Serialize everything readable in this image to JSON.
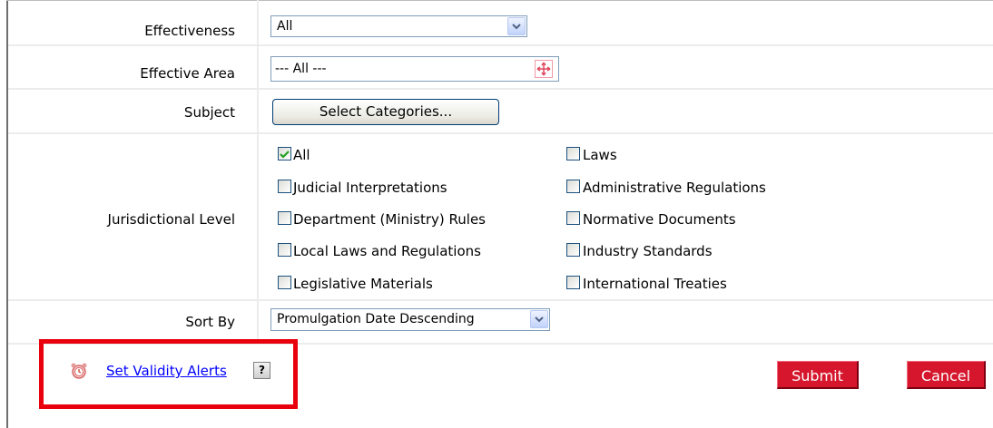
{
  "fields": {
    "effectiveness": {
      "label": "Effectiveness",
      "value": "All"
    },
    "effective_area": {
      "label": "Effective Area",
      "value": "--- All ---"
    },
    "subject": {
      "label": "Subject",
      "button": "Select Categories..."
    },
    "jurisdictional_level": {
      "label": "Jurisdictional Level",
      "options": [
        {
          "label": "All",
          "checked": true
        },
        {
          "label": "Laws",
          "checked": false
        },
        {
          "label": "Judicial Interpretations",
          "checked": false
        },
        {
          "label": "Administrative Regulations",
          "checked": false
        },
        {
          "label": "Department (Ministry) Rules",
          "checked": false
        },
        {
          "label": "Normative Documents",
          "checked": false
        },
        {
          "label": "Local Laws and Regulations",
          "checked": false
        },
        {
          "label": "Industry Standards",
          "checked": false
        },
        {
          "label": "Legislative Materials",
          "checked": false
        },
        {
          "label": "International Treaties",
          "checked": false
        }
      ]
    },
    "sort_by": {
      "label": "Sort By",
      "value": "Promulgation Date Descending"
    }
  },
  "alerts": {
    "link": "Set Validity Alerts",
    "help": "?"
  },
  "actions": {
    "submit": "Submit",
    "cancel": "Cancel"
  },
  "colors": {
    "accent_button": "#d5162c",
    "highlight_border": "#e8000d",
    "link": "#0000ff"
  }
}
